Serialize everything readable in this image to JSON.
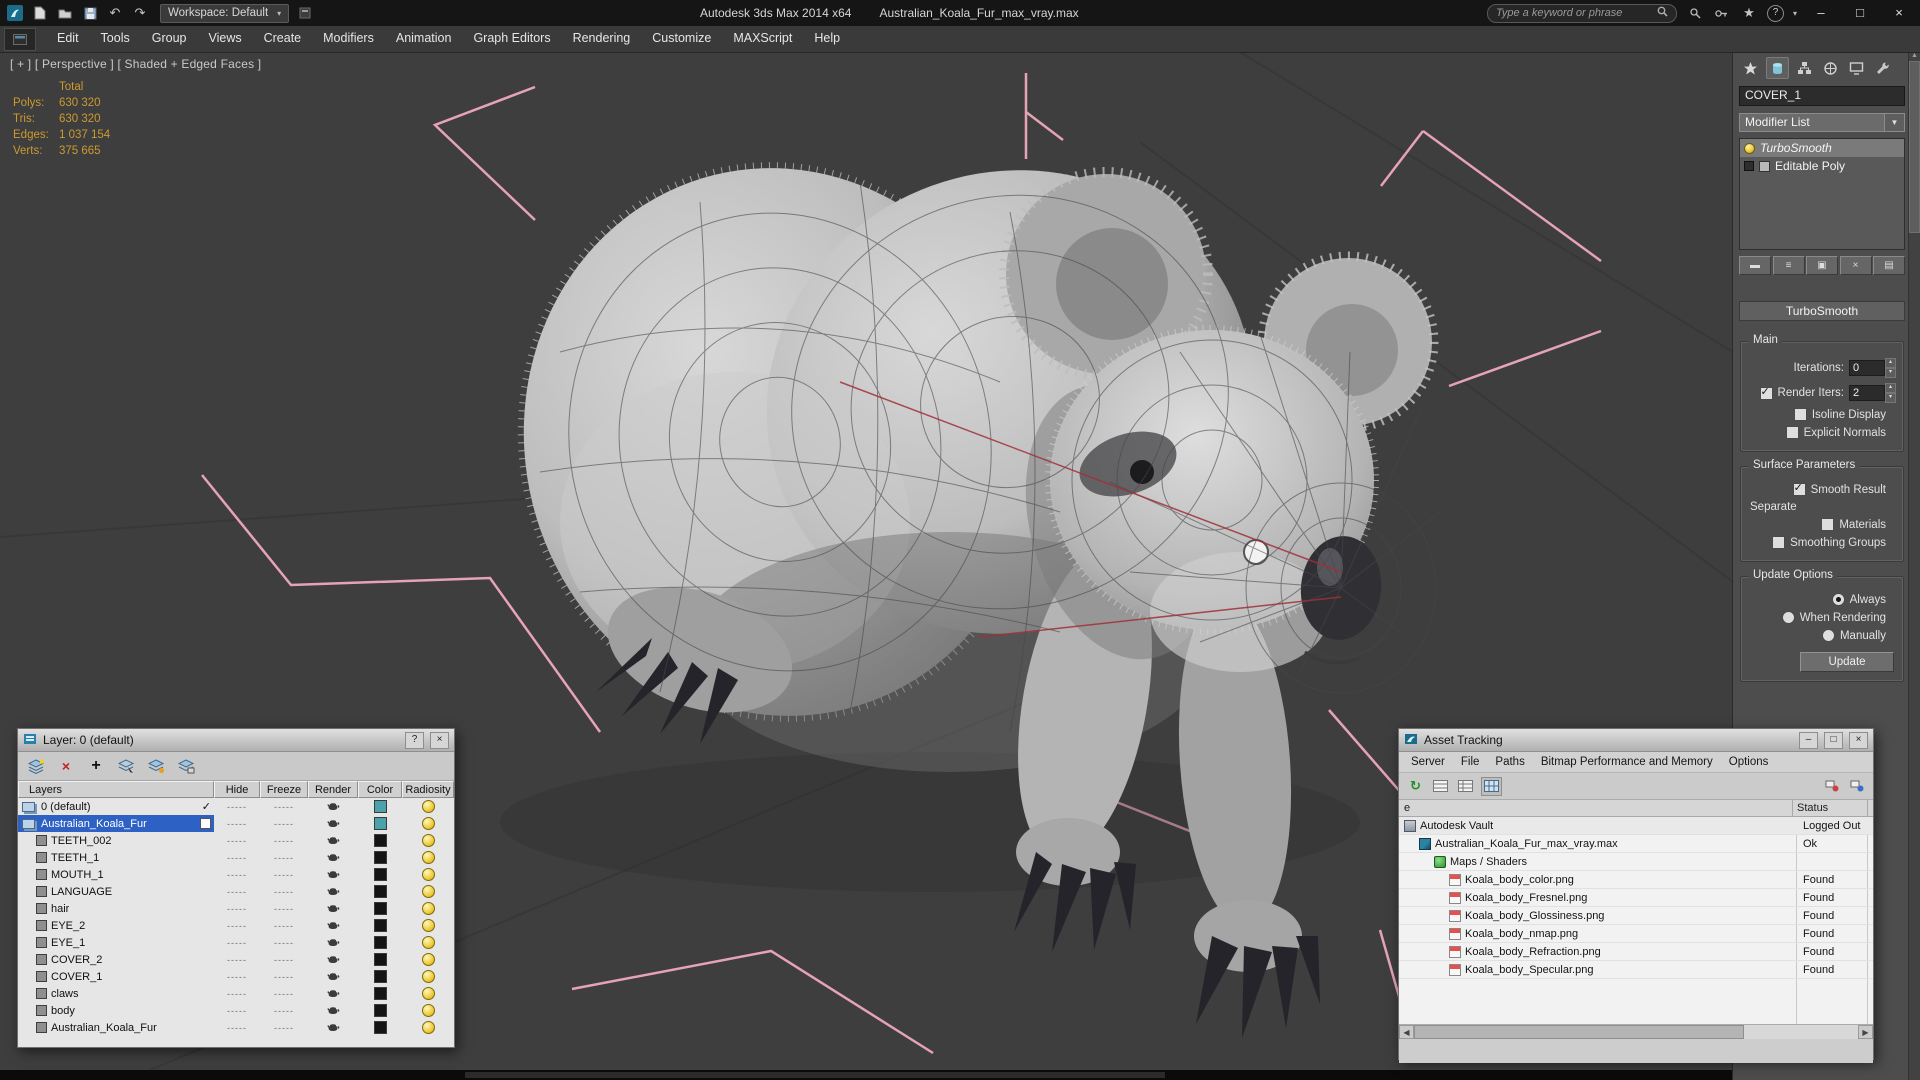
{
  "titlebar": {
    "app_title": "Autodesk 3ds Max 2014 x64",
    "file_title": "Australian_Koala_Fur_max_vray.max",
    "workspace_label": "Workspace: Default",
    "search_placeholder": "Type a keyword or phrase"
  },
  "menu_bar": {
    "items": [
      "Edit",
      "Tools",
      "Group",
      "Views",
      "Create",
      "Modifiers",
      "Animation",
      "Graph Editors",
      "Rendering",
      "Customize",
      "MAXScript",
      "Help"
    ]
  },
  "viewport": {
    "label": "[ + ] [ Perspective ] [ Shaded + Edged Faces ]",
    "stats": {
      "total_label": "Total",
      "rows": [
        {
          "label": "Polys:",
          "value": "630 320"
        },
        {
          "label": "Tris:",
          "value": "630 320"
        },
        {
          "label": "Edges:",
          "value": "1 037 154"
        },
        {
          "label": "Verts:",
          "value": "375 665"
        }
      ]
    }
  },
  "command_panel": {
    "object_name": "COVER_1",
    "modifier_list_label": "Modifier List",
    "stack": [
      {
        "label": "TurboSmooth",
        "active": true
      },
      {
        "label": "Editable Poly",
        "active": false
      }
    ],
    "turbosmooth": {
      "title": "TurboSmooth",
      "main_group": "Main",
      "iterations_label": "Iterations:",
      "iterations_value": "0",
      "render_iters_label": "Render Iters:",
      "render_iters_value": "2",
      "isoline_display_label": "Isoline Display",
      "explicit_normals_label": "Explicit Normals",
      "surface_parameters_group": "Surface Parameters",
      "smooth_result_label": "Smooth Result",
      "separate_label": "Separate",
      "materials_label": "Materials",
      "smoothing_groups_label": "Smoothing Groups",
      "update_options_group": "Update Options",
      "always_label": "Always",
      "when_rendering_label": "When Rendering",
      "manually_label": "Manually",
      "update_button": "Update"
    }
  },
  "layer_dialog": {
    "title": "Layer: 0 (default)",
    "help_button": "?",
    "dash_placeholder": "-----",
    "columns": [
      "Layers",
      "Hide",
      "Freeze",
      "Render",
      "Color",
      "Radiosity"
    ],
    "rows": [
      {
        "name": "0 (default)",
        "type": "layer",
        "level": 0,
        "current": true,
        "selected": false,
        "checkbox": false,
        "swatch": "#4aa2aa"
      },
      {
        "name": "Australian_Koala_Fur",
        "type": "layer",
        "level": 0,
        "current": false,
        "selected": true,
        "checkbox": true,
        "swatch": "#4aa2aa"
      },
      {
        "name": "TEETH_002",
        "type": "object",
        "level": 1,
        "swatch": "#141414"
      },
      {
        "name": "TEETH_1",
        "type": "object",
        "level": 1,
        "swatch": "#141414"
      },
      {
        "name": "MOUTH_1",
        "type": "object",
        "level": 1,
        "swatch": "#141414"
      },
      {
        "name": "LANGUAGE",
        "type": "object",
        "level": 1,
        "swatch": "#141414"
      },
      {
        "name": "hair",
        "type": "object",
        "level": 1,
        "swatch": "#141414"
      },
      {
        "name": "EYE_2",
        "type": "object",
        "level": 1,
        "swatch": "#141414"
      },
      {
        "name": "EYE_1",
        "type": "object",
        "level": 1,
        "swatch": "#141414"
      },
      {
        "name": "COVER_2",
        "type": "object",
        "level": 1,
        "swatch": "#141414"
      },
      {
        "name": "COVER_1",
        "type": "object",
        "level": 1,
        "swatch": "#141414"
      },
      {
        "name": "claws",
        "type": "object",
        "level": 1,
        "swatch": "#141414"
      },
      {
        "name": "body",
        "type": "object",
        "level": 1,
        "swatch": "#141414"
      },
      {
        "name": "Australian_Koala_Fur",
        "type": "object",
        "level": 1,
        "swatch": "#141414"
      }
    ]
  },
  "asset_tracking": {
    "title": "Asset Tracking",
    "menus": [
      "Server",
      "File",
      "Paths",
      "Bitmap Performance and Memory",
      "Options"
    ],
    "name_column_header": "e",
    "status_column_header": "Status",
    "rows": [
      {
        "name": "Autodesk Vault",
        "status": "Logged Out",
        "level": 0,
        "icon": "vault"
      },
      {
        "name": "Australian_Koala_Fur_max_vray.max",
        "status": "Ok",
        "level": 1,
        "icon": "max"
      },
      {
        "name": "Maps / Shaders",
        "status": "",
        "level": 2,
        "icon": "maps"
      },
      {
        "name": "Koala_body_color.png",
        "status": "Found",
        "level": 3,
        "icon": "png"
      },
      {
        "name": "Koala_body_Fresnel.png",
        "status": "Found",
        "level": 3,
        "icon": "png"
      },
      {
        "name": "Koala_body_Glossiness.png",
        "status": "Found",
        "level": 3,
        "icon": "png"
      },
      {
        "name": "Koala_body_nmap.png",
        "status": "Found",
        "level": 3,
        "icon": "png"
      },
      {
        "name": "Koala_body_Refraction.png",
        "status": "Found",
        "level": 3,
        "icon": "png"
      },
      {
        "name": "Koala_body_Specular.png",
        "status": "Found",
        "level": 3,
        "icon": "png"
      }
    ]
  },
  "colors": {
    "selection_blue": "#2e61c4",
    "stats_orange": "#cc9a30",
    "helper_pink": "#efa9bd",
    "layer_swatch_teal": "#4aa2aa",
    "viewport_background": "#3e3e3e"
  }
}
